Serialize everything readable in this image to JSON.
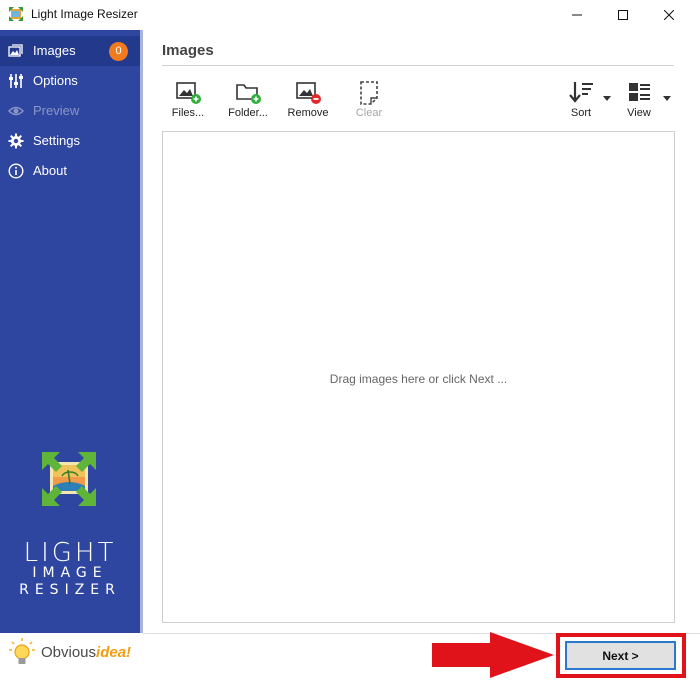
{
  "window": {
    "title": "Light Image Resizer",
    "icons": {
      "app": "app-icon",
      "minimize": "minimize-icon",
      "maximize": "maximize-icon",
      "close": "close-icon"
    }
  },
  "sidebar": {
    "background": "#2f46a0",
    "items": [
      {
        "label": "Images",
        "icon": "images-icon",
        "state": "active",
        "badge": "0"
      },
      {
        "label": "Options",
        "icon": "sliders-icon",
        "state": "normal"
      },
      {
        "label": "Preview",
        "icon": "eye-icon",
        "state": "disabled"
      },
      {
        "label": "Settings",
        "icon": "gear-icon",
        "state": "normal"
      },
      {
        "label": "About",
        "icon": "info-icon",
        "state": "normal"
      }
    ],
    "logo_lines": [
      "LIGHT",
      "IMAGE",
      "RESIZER"
    ],
    "brand": {
      "prefix": "Obvious",
      "accent": "idea!",
      "accent_color": "#f39c12"
    }
  },
  "main": {
    "section_title": "Images",
    "toolbar": [
      {
        "label": "Files...",
        "icon": "add-image-icon",
        "enabled": true
      },
      {
        "label": "Folder...",
        "icon": "add-folder-icon",
        "enabled": true
      },
      {
        "label": "Remove",
        "icon": "remove-image-icon",
        "enabled": true
      },
      {
        "label": "Clear",
        "icon": "clear-icon",
        "enabled": false
      },
      {
        "label": "Sort",
        "icon": "sort-icon",
        "enabled": true,
        "dropdown": true
      },
      {
        "label": "View",
        "icon": "view-list-icon",
        "enabled": true,
        "dropdown": true
      }
    ],
    "drop_hint": "Drag images here or click Next ..."
  },
  "footer": {
    "next_label": "Next >",
    "annotation_color": "#e0131a"
  }
}
